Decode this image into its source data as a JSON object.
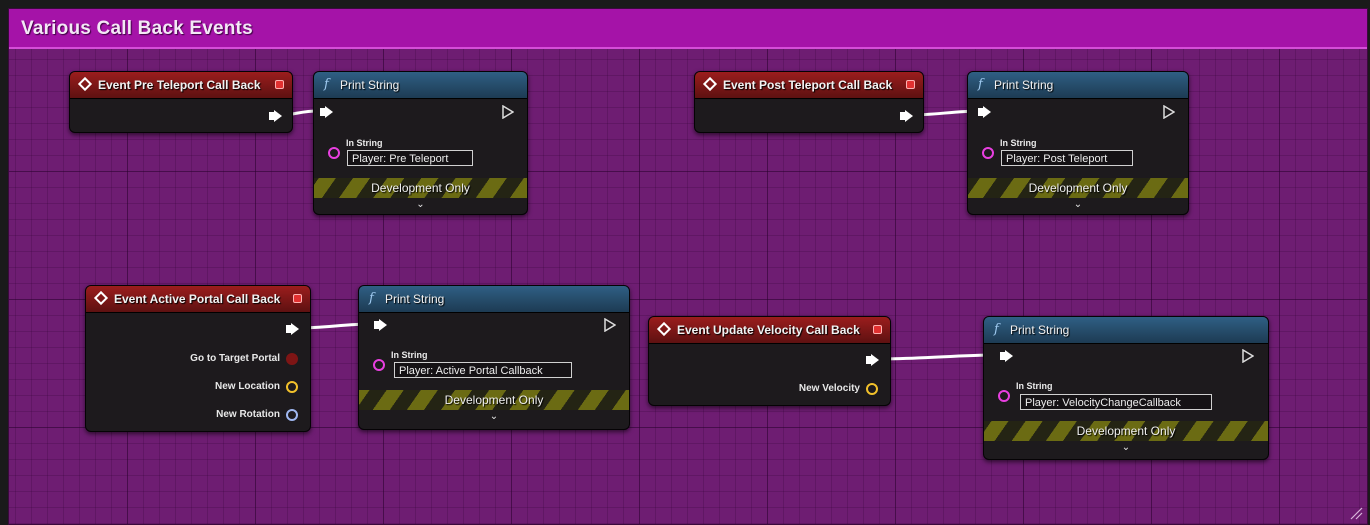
{
  "comment": {
    "title": "Various Call Back Events",
    "color": "#a513a8"
  },
  "colors": {
    "event_header": "#9b1d1d",
    "function_header": "#2f5f84",
    "exec_wire": "#ffffff",
    "string_pin": "#e83fe0",
    "vector_pin": "#f2c12b",
    "rotator_pin": "#9fb7f0",
    "object_pin": "#b01919"
  },
  "nodes": {
    "event_pre_teleport": {
      "title": "Event Pre Teleport Call Back",
      "icon": "event-diamond-icon"
    },
    "print_pre": {
      "title": "Print String",
      "in_string_label": "In String",
      "in_string_value": "Player: Pre Teleport",
      "dev_only": "Development Only"
    },
    "event_post_teleport": {
      "title": "Event Post Teleport Call Back",
      "icon": "event-diamond-icon"
    },
    "print_post": {
      "title": "Print String",
      "in_string_label": "In String",
      "in_string_value": "Player: Post Teleport",
      "dev_only": "Development Only"
    },
    "event_active_portal": {
      "title": "Event Active Portal Call Back",
      "icon": "event-diamond-icon",
      "pins": [
        "Go to Target Portal",
        "New Location",
        "New Rotation"
      ]
    },
    "print_active": {
      "title": "Print String",
      "in_string_label": "In String",
      "in_string_value": "Player: Active Portal Callback",
      "dev_only": "Development Only"
    },
    "event_update_velocity": {
      "title": "Event Update Velocity Call Back",
      "icon": "event-diamond-icon",
      "pins": [
        "New Velocity"
      ]
    },
    "print_velocity": {
      "title": "Print String",
      "in_string_label": "In String",
      "in_string_value": "Player: VelocityChangeCallback",
      "dev_only": "Development Only"
    }
  }
}
